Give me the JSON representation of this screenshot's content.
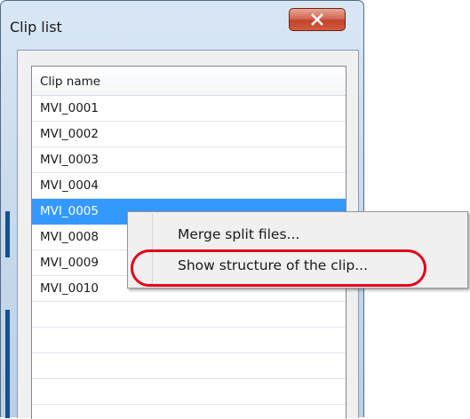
{
  "window": {
    "title": "Clip list",
    "close_icon": "close-icon",
    "close_color": "#c7432c"
  },
  "list": {
    "column_header": "Clip name",
    "rows": [
      "MVI_0001",
      "MVI_0002",
      "MVI_0003",
      "MVI_0004",
      "MVI_0005",
      "MVI_0008",
      "MVI_0009",
      "MVI_0010"
    ],
    "selected_row": "MVI_0005",
    "selection_color": "#3399ff"
  },
  "context_menu": {
    "items": [
      "Merge split files...",
      "Show structure of the clip..."
    ],
    "highlighted_item": "Show structure of the clip...",
    "highlight_color": "#e2001a"
  }
}
